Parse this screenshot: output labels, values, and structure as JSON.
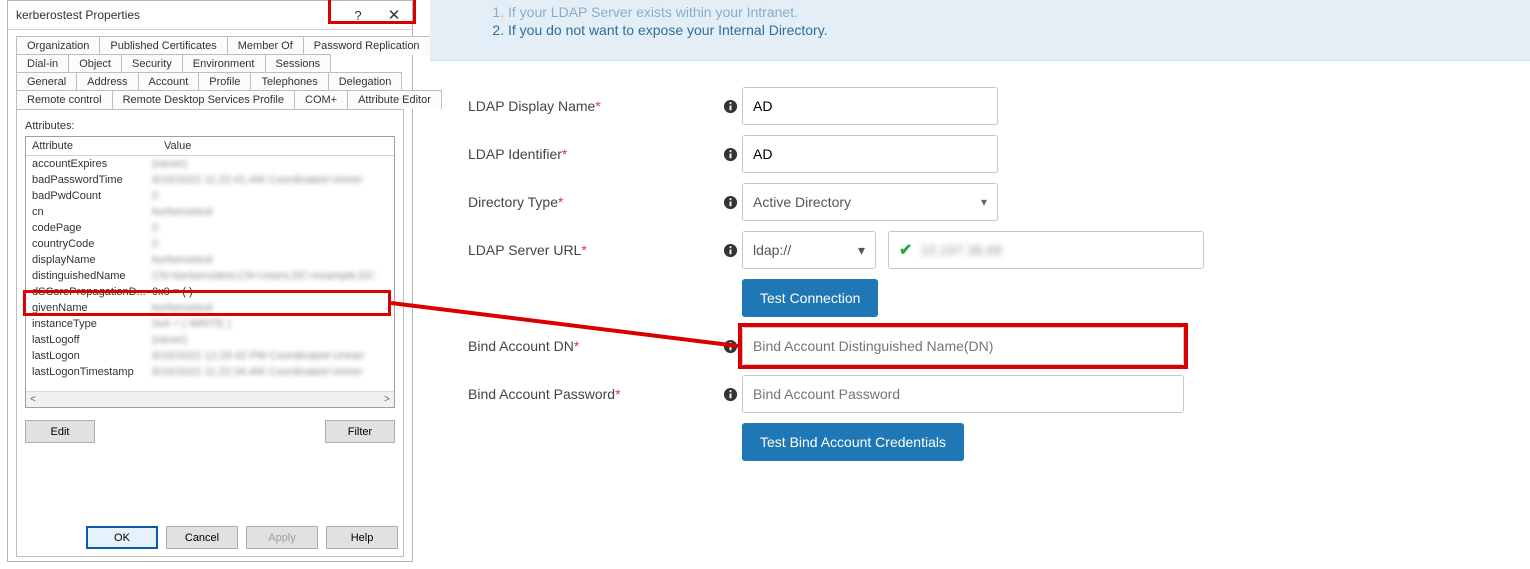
{
  "dialog": {
    "title": "kerberostest Properties",
    "help_symbol": "?",
    "close_symbol": "✕",
    "tab_rows": [
      [
        "Organization",
        "Published Certificates",
        "Member Of",
        "Password Replication"
      ],
      [
        "Dial-in",
        "Object",
        "Security",
        "Environment",
        "Sessions"
      ],
      [
        "General",
        "Address",
        "Account",
        "Profile",
        "Telephones",
        "Delegation"
      ],
      [
        "Remote control",
        "Remote Desktop Services Profile",
        "COM+",
        "Attribute Editor"
      ]
    ],
    "highlight_tab": "Attribute Editor",
    "attributes_label": "Attributes:",
    "columns": {
      "attr": "Attribute",
      "value": "Value"
    },
    "rows": [
      {
        "a": "accountExpires",
        "v": "(never)"
      },
      {
        "a": "badPasswordTime",
        "v": "6/16/2022 11:22:41 AM Coordinated Univer"
      },
      {
        "a": "badPwdCount",
        "v": "0"
      },
      {
        "a": "cn",
        "v": "kerberostest"
      },
      {
        "a": "codePage",
        "v": "0"
      },
      {
        "a": "countryCode",
        "v": "0"
      },
      {
        "a": "displayName",
        "v": "kerberostest"
      },
      {
        "a": "distinguishedName",
        "v": "CN=kerberostest,CN=Users,DC=example,DC"
      },
      {
        "a": "dSCorePropagationD...",
        "v": "0x0 = (  )",
        "noblur": true
      },
      {
        "a": "givenName",
        "v": "kerberostest"
      },
      {
        "a": "instanceType",
        "v": "0x4 = ( WRITE )"
      },
      {
        "a": "lastLogoff",
        "v": "(never)"
      },
      {
        "a": "lastLogon",
        "v": "6/16/2022 12:29:42 PM Coordinated Univer"
      },
      {
        "a": "lastLogonTimestamp",
        "v": "6/16/2022 11:22:34 AM Coordinated Univer"
      }
    ],
    "highlight_row_attr": "distinguishedName",
    "scroll_left": "<",
    "scroll_right": ">",
    "edit_btn": "Edit",
    "filter_btn": "Filter",
    "ok": "OK",
    "cancel": "Cancel",
    "apply": "Apply",
    "help": "Help"
  },
  "form": {
    "info_items": [
      "If your LDAP Server exists within your Intranet.",
      "If you do not want to expose your Internal Directory."
    ],
    "ldap_display_name": {
      "label": "LDAP Display Name",
      "value": "AD"
    },
    "ldap_identifier": {
      "label": "LDAP Identifier",
      "value": "AD"
    },
    "directory_type": {
      "label": "Directory Type",
      "value": "Active Directory"
    },
    "ldap_server_url": {
      "label": "LDAP Server URL",
      "scheme": "ldap://",
      "host": "10.197.38.68"
    },
    "test_connection": "Test Connection",
    "bind_account_dn": {
      "label": "Bind Account DN",
      "placeholder": "Bind Account Distinguished Name(DN)"
    },
    "bind_account_pwd": {
      "label": "Bind Account Password",
      "placeholder": "Bind Account Password"
    },
    "test_bind": "Test Bind Account Credentials"
  }
}
